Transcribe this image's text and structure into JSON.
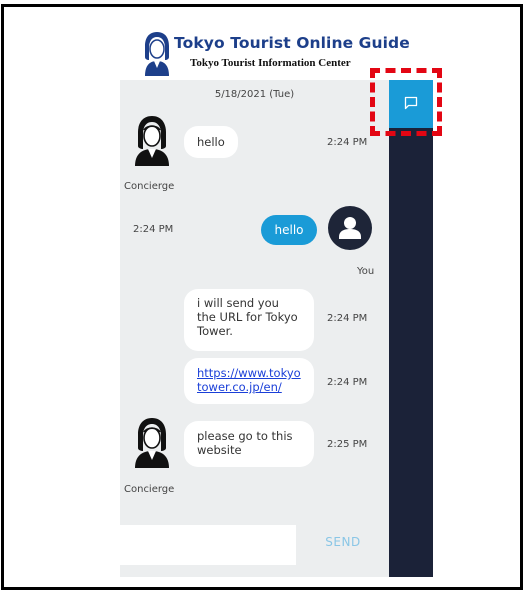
{
  "header": {
    "title": "Tokyo Tourist Online Guide",
    "subtitle": "Tokyo Tourist Information Center"
  },
  "chat": {
    "date": "5/18/2021 (Tue)",
    "messages": [
      {
        "sender": "Concierge",
        "text": "hello",
        "time": "2:24 PM"
      },
      {
        "sender": "You",
        "text": "hello",
        "time": "2:24 PM"
      },
      {
        "sender": "Concierge",
        "text": "i will send you the URL for Tokyo Tower.",
        "time": "2:24 PM"
      },
      {
        "sender": "Concierge",
        "text": "https://www.tokyotower.co.jp/en/",
        "time": "2:24 PM"
      },
      {
        "sender": "Concierge",
        "text": "please go to this website",
        "time": "2:25 PM"
      }
    ],
    "agent_label": "Concierge",
    "user_label": "You"
  },
  "composer": {
    "placeholder": "",
    "send_label": "SEND"
  },
  "sidebar": {
    "chat_tab_icon": "chat-bubble-icon"
  },
  "colors": {
    "accent": "#1a9bd7",
    "sidebar": "#1b2238",
    "chat_bg": "#eceeef",
    "highlight": "#e30613"
  }
}
